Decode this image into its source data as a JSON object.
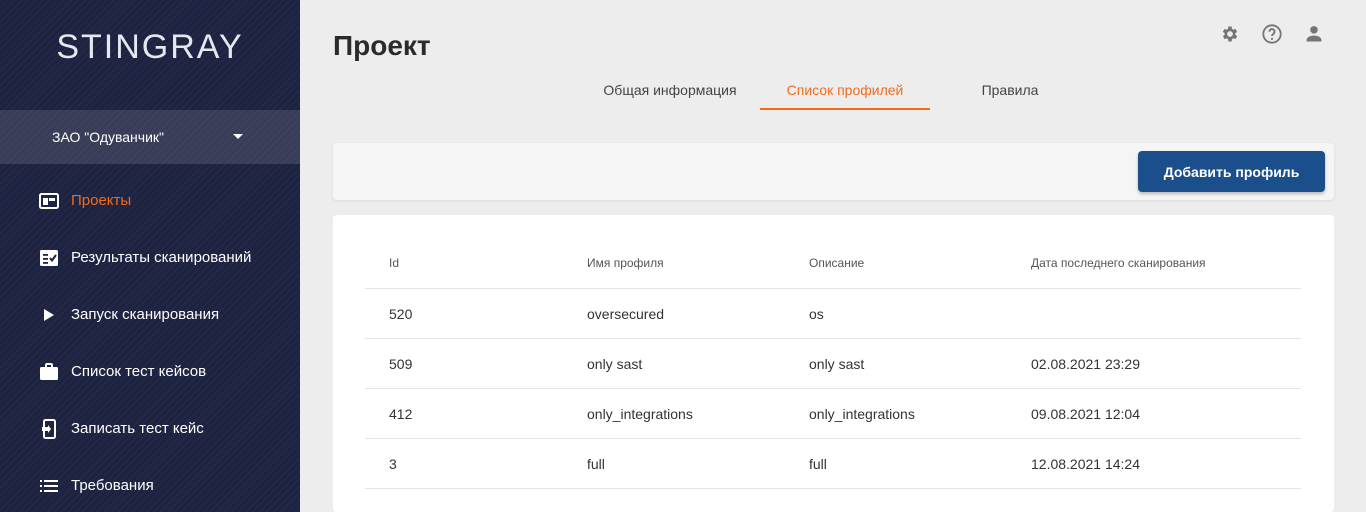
{
  "sidebar": {
    "logo": "STINGRAY",
    "organization": "ЗАО \"Одуванчик\"",
    "items": [
      {
        "label": "Проекты",
        "icon": "projects-icon",
        "active": true
      },
      {
        "label": "Результаты сканирований",
        "icon": "scan-results-icon",
        "active": false
      },
      {
        "label": "Запуск сканирования",
        "icon": "play-icon",
        "active": false
      },
      {
        "label": "Список тест кейсов",
        "icon": "briefcase-icon",
        "active": false
      },
      {
        "label": "Записать тест кейс",
        "icon": "record-device-icon",
        "active": false
      },
      {
        "label": "Требования",
        "icon": "list-icon",
        "active": false
      }
    ]
  },
  "header": {
    "title": "Проект",
    "icons": [
      "settings-icon",
      "help-icon",
      "user-icon"
    ]
  },
  "tabs": [
    {
      "label": "Общая информация",
      "active": false
    },
    {
      "label": "Список профилей",
      "active": true
    },
    {
      "label": "Правила",
      "active": false
    }
  ],
  "toolbar": {
    "add_profile_label": "Добавить профиль"
  },
  "table": {
    "columns": [
      "Id",
      "Имя профиля",
      "Описание",
      "Дата последнего сканирования"
    ],
    "rows": [
      [
        "520",
        "oversecured",
        "os",
        ""
      ],
      [
        "509",
        "only sast",
        "only sast",
        "02.08.2021 23:29"
      ],
      [
        "412",
        "only_integrations",
        "only_integrations",
        "09.08.2021 12:04"
      ],
      [
        "3",
        "full",
        "full",
        "12.08.2021 14:24"
      ]
    ]
  },
  "colors": {
    "accent": "#f26b1d",
    "sidebar_bg": "#1e2341",
    "primary_button": "#1b4f8c"
  }
}
